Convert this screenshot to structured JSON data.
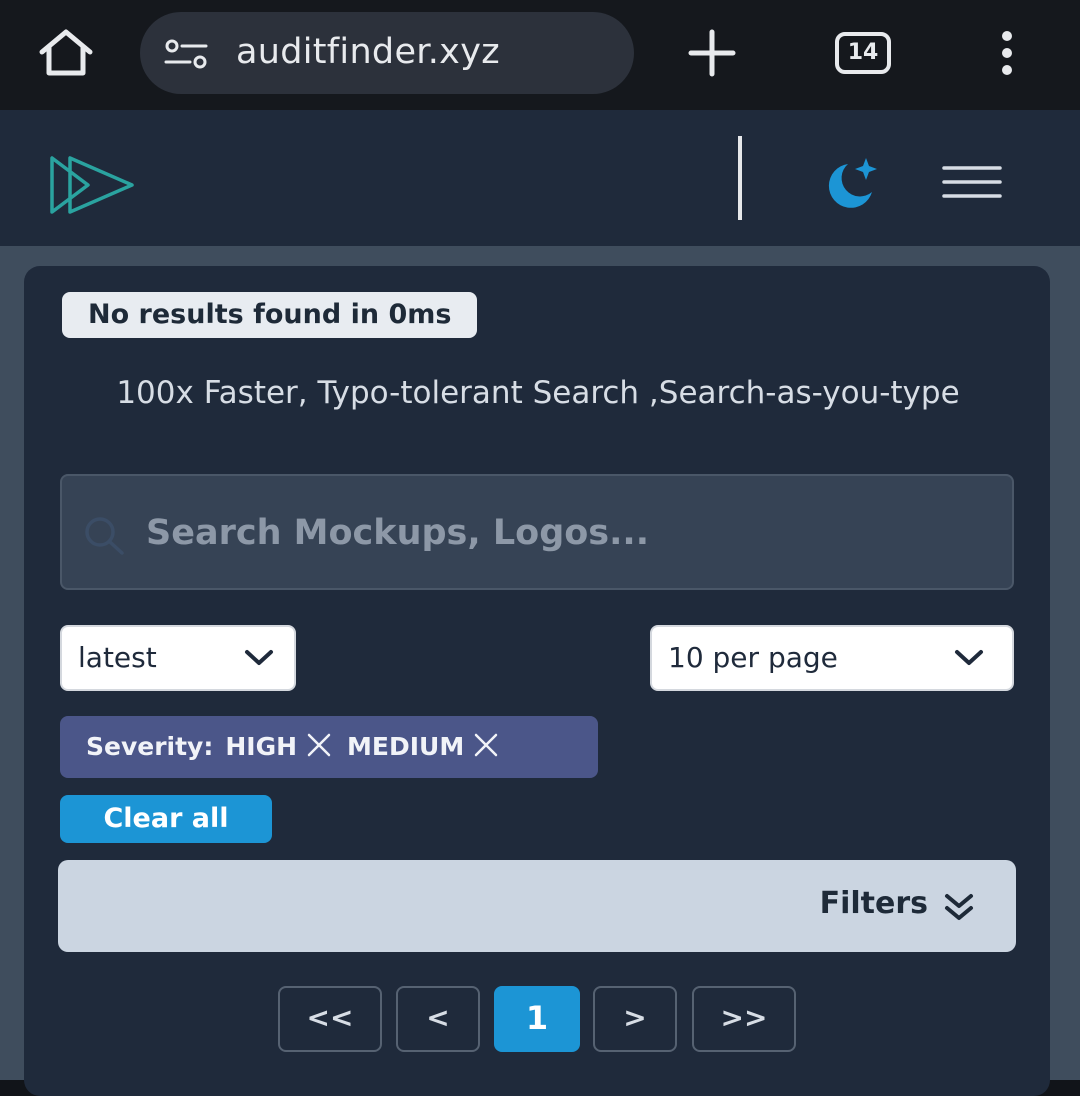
{
  "browser": {
    "url": "auditfinder.xyz",
    "tab_count": "14",
    "icons": [
      "home-icon",
      "site-settings-icon",
      "plus-icon",
      "tab-count-icon",
      "more-vertical-icon"
    ]
  },
  "header": {
    "icons": [
      "play-logo-icon",
      "moon-stars-icon",
      "hamburger-menu-icon"
    ],
    "accent_color": "#2f9ec9"
  },
  "search": {
    "results_status": "No results found in 0ms",
    "tagline": "100x Faster, Typo-tolerant Search ,Search-as-you-type",
    "placeholder": "Search Mockups, Logos...",
    "value": ""
  },
  "controls": {
    "sort": {
      "selected": "latest"
    },
    "per_page": {
      "selected": "10 per page"
    }
  },
  "active_filters": {
    "label": "Severity:",
    "values": [
      "HIGH",
      "MEDIUM"
    ],
    "clear_all_label": "Clear all"
  },
  "filters_panel": {
    "label": "Filters"
  },
  "pagination": {
    "first": "<<",
    "prev": "<",
    "current": "1",
    "next": ">",
    "last": ">>"
  },
  "colors": {
    "header_bg": "#1f2a3b",
    "primary_button": "#1c95d5",
    "chip_bg": "#4b5689",
    "filters_bar": "#cbd5e1"
  }
}
